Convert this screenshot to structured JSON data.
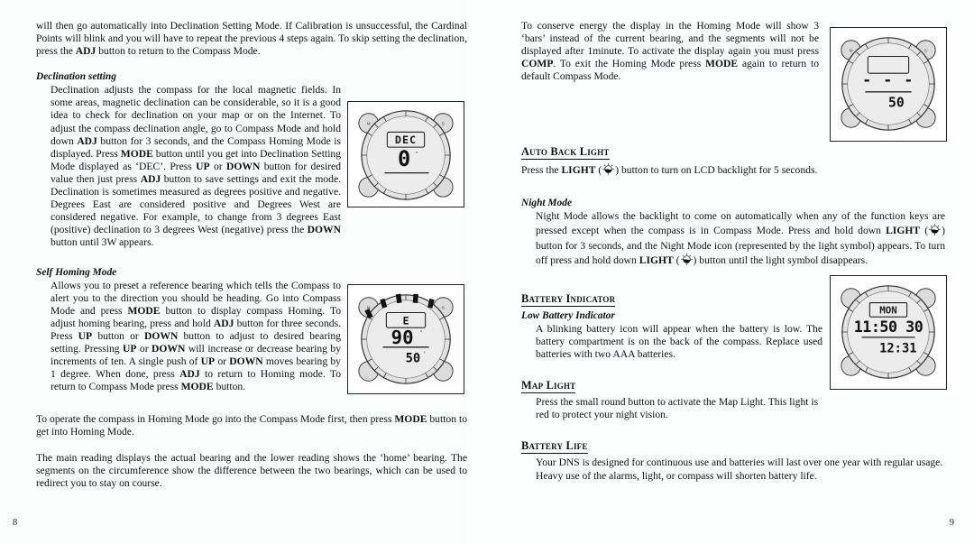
{
  "document": {
    "type": "compass-user-manual-spread",
    "left_page_number": "8",
    "right_page_number": "9"
  },
  "left_page": {
    "intro_paragraph": "will then go automatically into Declination Setting Mode. If Calibration is unsuccessful, the Cardinal Points will blink and you will have to repeat the previous 4 steps again. To skip setting the declination, press the ADJ button to return to the Compass Mode.",
    "intro_parts": {
      "p1": "will then go automatically into Declination Setting Mode. If Calibration is unsuccessful, the Cardinal Points will blink and you will have to repeat the previous 4 steps again. To skip setting the declination, press the ",
      "b1": "ADJ",
      "p2": " button to return to the Compass Mode."
    },
    "declination": {
      "heading": "Declination setting",
      "parts": {
        "t1": "Declination adjusts the compass for the local magnetic fields. In some areas, magnetic declination can be considerable, so it is a good idea to check for declination on your map or on the Internet. To adjust the compass declination angle, go to Compass Mode and hold down ",
        "b1": "ADJ",
        "t2": " button for 3 seconds, and the Compass Homing Mode is displayed. Press ",
        "b2": "MODE",
        "t3": " button until you get into Declination Setting Mode displayed as ‘DEC’. Press ",
        "b3": "UP",
        "t4": " or ",
        "b4": "DOWN",
        "t5": " button for desired value then just press ",
        "b5": "ADJ",
        "t6": " button to save settings and exit the mode.   Declination is sometimes measured as degrees positive and negative.  Degrees East are considered positive and Degrees West are considered negative.  For example, to change from 3 degrees East (positive)  declination to 3 degrees West (negative) press the ",
        "b6": "DOWN",
        "t7": " button until 3W appears."
      },
      "figure": {
        "name": "compass-declination-display",
        "lcd_mode_label": "DEC",
        "lcd_value": "0",
        "left_button_label": "M",
        "right_button_label": "S"
      }
    },
    "self_homing": {
      "heading": "Self Homing Mode",
      "parts": {
        "t1": "Allows you to preset a reference bearing which tells the Compass to alert you to the direction you should be heading. Go into Compass Mode and press ",
        "b1": "MODE",
        "t2": " button to display compass Homing. To adjust homing bearing, press and hold ",
        "b2": "ADJ",
        "t3": " button for three seconds.  Press ",
        "b3": "UP",
        "t4": " button or ",
        "b4": "DOWN",
        "t5": " button to adjust to desired bearing setting. Pressing ",
        "b5": "UP",
        "t6": " or ",
        "b6": "DOWN",
        "t7": " will increase or decrease bearing by increments of ten. A single push of ",
        "b7": "UP",
        "t8": " or ",
        "b8": "DOWN",
        "t9": " moves bearing by 1 degree.  When done, press ",
        "b9": "ADJ",
        "t10": " to return to Homing mode.  To return to Compass Mode press ",
        "b10": "MODE",
        "t11": " button."
      },
      "figure": {
        "name": "compass-homing-display",
        "lcd_mode_label": "E",
        "lcd_main_value": "90",
        "lcd_lower_value": "50",
        "segment_count": 5
      }
    },
    "homing_operation": {
      "parts": {
        "t1": "To operate the compass in Homing Mode go into the Compass Mode first, then press ",
        "b1": "MODE",
        "t2": " button to get into Homing Mode."
      }
    },
    "segments_paragraph": "The main reading displays the actual bearing and the lower reading shows the ‘home’ bearing. The segments on the circumference show the difference between the two bearings, which can be used to redirect you to stay on course."
  },
  "right_page": {
    "conserve_energy": {
      "parts": {
        "t1": "To conserve energy the display in the Homing Mode will show 3 ‘bars’ instead of the current bearing, and the segments will not be displayed after 1minute. To activate the display again you must press ",
        "b1": "COMP",
        "t2": ". To exit the Homing Mode press ",
        "b2": "MODE",
        "t3": " again to return to default Compass Mode."
      },
      "figure": {
        "name": "compass-energy-save-display",
        "lcd_mode_label": "",
        "lcd_bars": "- - -",
        "lcd_lower_value": "50"
      }
    },
    "auto_back_light": {
      "heading": "Auto Back Light",
      "parts": {
        "t1": "Press the ",
        "b1": "LIGHT",
        "t2": " (",
        "icon": "light-icon",
        "t3": ") button to turn on LCD backlight for 5 seconds."
      }
    },
    "night_mode": {
      "heading": "Night Mode",
      "parts": {
        "t1": "Night Mode allows the backlight to come on automatically when any of the function keys are pressed except when the compass is in Compass Mode. Press and hold down ",
        "b1": "LIGHT",
        "t2": " (",
        "t3": ") button for 3 seconds, and the Night Mode icon (represented by the light symbol) appears. To turn off press and hold down ",
        "b2": "LIGHT",
        "t4": " (",
        "t5": ") button until the light symbol disappears."
      }
    },
    "battery_indicator": {
      "heading": "Battery Indicator",
      "sub_heading": "Low Battery Indicator",
      "body": "A blinking battery icon will appear when the battery is low.  The battery compartment is on the back of the compass.  Replace used batteries with two AAA batteries.",
      "figure": {
        "name": "compass-time-display",
        "lcd_mode_label": "MON",
        "lcd_main_value": "11:50 30",
        "lcd_lower_value": "12:31"
      }
    },
    "map_light": {
      "heading": "Map Light",
      "body": "Press the small round button to activate the Map Light.  This light is red to protect your night vision."
    },
    "battery_life": {
      "heading": "Battery Life",
      "body": "Your DNS is designed for continuous use and batteries will last over one year with regular usage. Heavy use of the alarms, light, or compass will shorten battery life."
    }
  },
  "colors": {
    "page_background": "#fbfdfd",
    "text": "#101010",
    "figure_border": "#222222",
    "lcd_face": "#e9e9e9"
  }
}
